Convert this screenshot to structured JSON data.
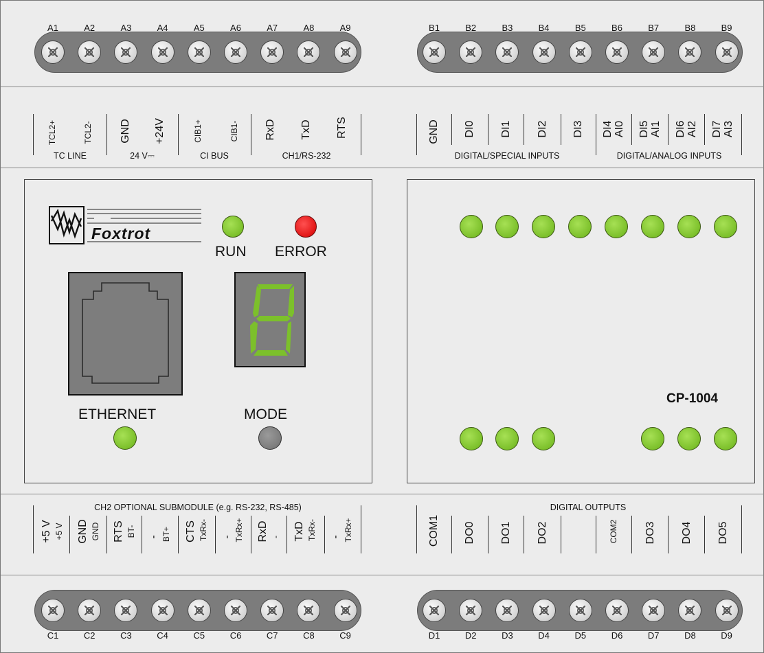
{
  "device": {
    "model": "CP-1004",
    "brand": "Foxtrot",
    "colors": {
      "led_green": "#7cc02b",
      "led_red": "#e21616",
      "mode_button": "#7c7c7c",
      "segment_digit": "#7cc02b"
    }
  },
  "terminals": {
    "top_left": [
      "A1",
      "A2",
      "A3",
      "A4",
      "A5",
      "A6",
      "A7",
      "A8",
      "A9"
    ],
    "top_right": [
      "B1",
      "B2",
      "B3",
      "B4",
      "B5",
      "B6",
      "B7",
      "B8",
      "B9"
    ],
    "bottom_left": [
      "C1",
      "C2",
      "C3",
      "C4",
      "C5",
      "C6",
      "C7",
      "C8",
      "C9"
    ],
    "bottom_right": [
      "D1",
      "D2",
      "D3",
      "D4",
      "D5",
      "D6",
      "D7",
      "D8",
      "D9"
    ]
  },
  "top_strip": {
    "signals_left": [
      "TCL2+",
      "TCL2-",
      "GND",
      "+24V",
      "CIB1+",
      "CIB1-",
      "RxD",
      "TxD",
      "RTS"
    ],
    "groups_left": [
      "TC LINE",
      "24 V⎓",
      "CI BUS",
      "CH1/RS-232"
    ],
    "signals_right": [
      "GND",
      "DI0",
      "DI1",
      "DI2",
      "DI3"
    ],
    "signals_right_dual": [
      [
        "DI4",
        "AI0"
      ],
      [
        "DI5",
        "AI1"
      ],
      [
        "DI6",
        "AI2"
      ],
      [
        "DI7",
        "AI3"
      ]
    ],
    "groups_right": [
      "DIGITAL/SPECIAL INPUTS",
      "DIGITAL/ANALOG INPUTS"
    ]
  },
  "front_panel": {
    "leds": {
      "run": "RUN",
      "error": "ERROR"
    },
    "ethernet_label": "ETHERNET",
    "mode_label": "MODE",
    "display_digit": "8"
  },
  "bottom_strip": {
    "left_title": "CH2 OPTIONAL SUBMODULE (e.g. RS-232, RS-485)",
    "left_main": [
      "+5 V",
      "GND",
      "RTS",
      "-",
      "CTS",
      "-",
      "RxD",
      "TxD",
      "-"
    ],
    "left_sub": [
      "+5 V",
      "GND",
      "BT-",
      "BT+",
      "TxRx-",
      "TxRx+",
      "-",
      "TxRx-",
      "TxRx+"
    ],
    "right_title": "DIGITAL OUTPUTS",
    "right_signals": [
      "COM1",
      "DO0",
      "DO1",
      "DO2",
      "COM2",
      "DO3",
      "DO4",
      "DO5"
    ]
  }
}
